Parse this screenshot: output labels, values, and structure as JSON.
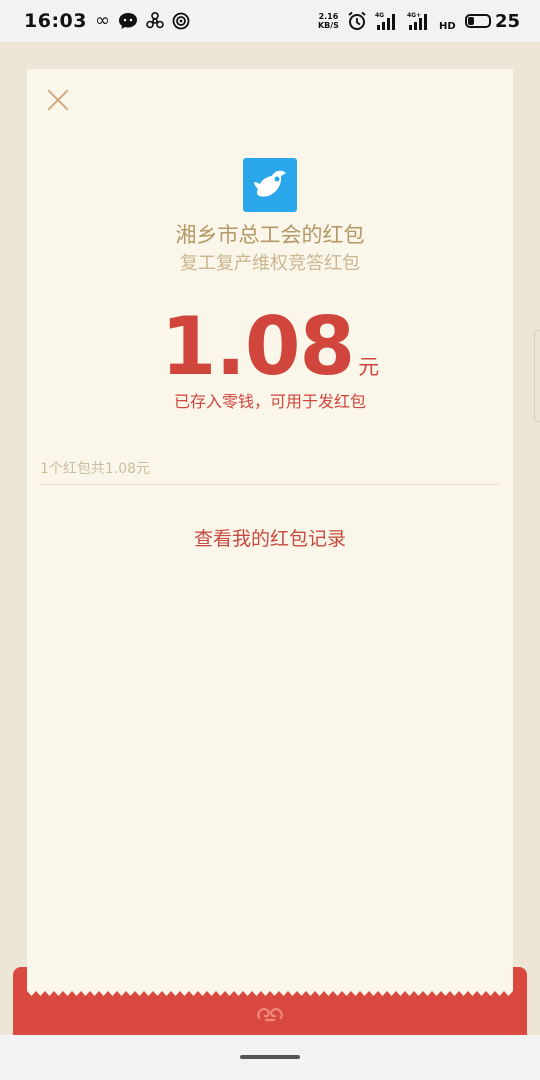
{
  "status_bar": {
    "time": "16:03",
    "net_speed_value": "2.16",
    "net_speed_unit": "KB/S",
    "battery": "25",
    "icons": [
      "infinity-icon",
      "chat-bubble-icon",
      "fan-icon",
      "hotspot-icon",
      "alarm-icon",
      "signal-4g-icon",
      "signal-4g-plus-icon",
      "hd-icon",
      "battery-icon"
    ],
    "signal_labels": [
      "4G",
      "4G+"
    ],
    "hd_label": "HD"
  },
  "red_packet": {
    "sender": "湘乡市总工会的红包",
    "subtitle": "复工复产维权竞答红包",
    "amount": "1.08",
    "unit": "元",
    "saved_note": "已存入零钱，可用于发红包",
    "summary": "1个红包共1.08元",
    "records_link": "查看我的红包记录"
  },
  "colors": {
    "background": "#ede6d6",
    "paper": "#faf6ea",
    "accent_red": "#d1463c",
    "envelope_red": "#d9493f",
    "gold_text": "#b49966",
    "avatar_blue": "#2aa6ea"
  }
}
